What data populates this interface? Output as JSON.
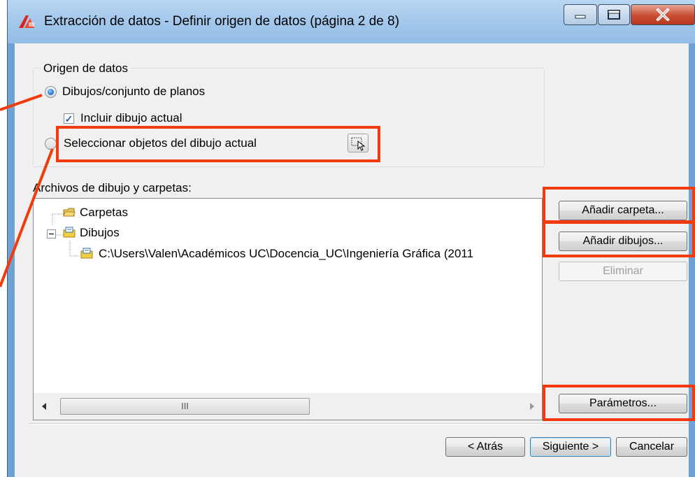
{
  "window": {
    "title": "Extracción de datos - Definir origen de datos (página 2 de 8)"
  },
  "data_source": {
    "group_label": "Origen de datos",
    "option_drawings": {
      "label": "Dibujos/conjunto de planos",
      "selected": true
    },
    "include_current": {
      "label": "Incluir dibujo actual",
      "checked": true
    },
    "option_select_objects": {
      "label": "Seleccionar objetos del dibujo actual",
      "selected": false
    }
  },
  "files": {
    "label": "Archivos de dibujo y carpetas:",
    "tree": [
      {
        "label": "Carpetas",
        "icon": "folder-icon"
      },
      {
        "label": "Dibujos",
        "icon": "drawings-icon"
      },
      {
        "label": "C:\\Users\\Valen\\Académicos UC\\Docencia_UC\\Ingeniería Gráfica (2011",
        "icon": "drawing-file-icon"
      }
    ],
    "scrollbar_grip": "III"
  },
  "buttons": {
    "add_folder": "Añadir carpeta...",
    "add_drawings": "Añadir dibujos...",
    "remove": "Eliminar",
    "parameters": "Parámetros...",
    "back": "< Atrás",
    "next": "Siguiente >",
    "cancel": "Cancelar"
  },
  "colors": {
    "highlight": "#f23a0b",
    "titlebar": "#a6c9ec",
    "close_button": "#c94d32"
  }
}
